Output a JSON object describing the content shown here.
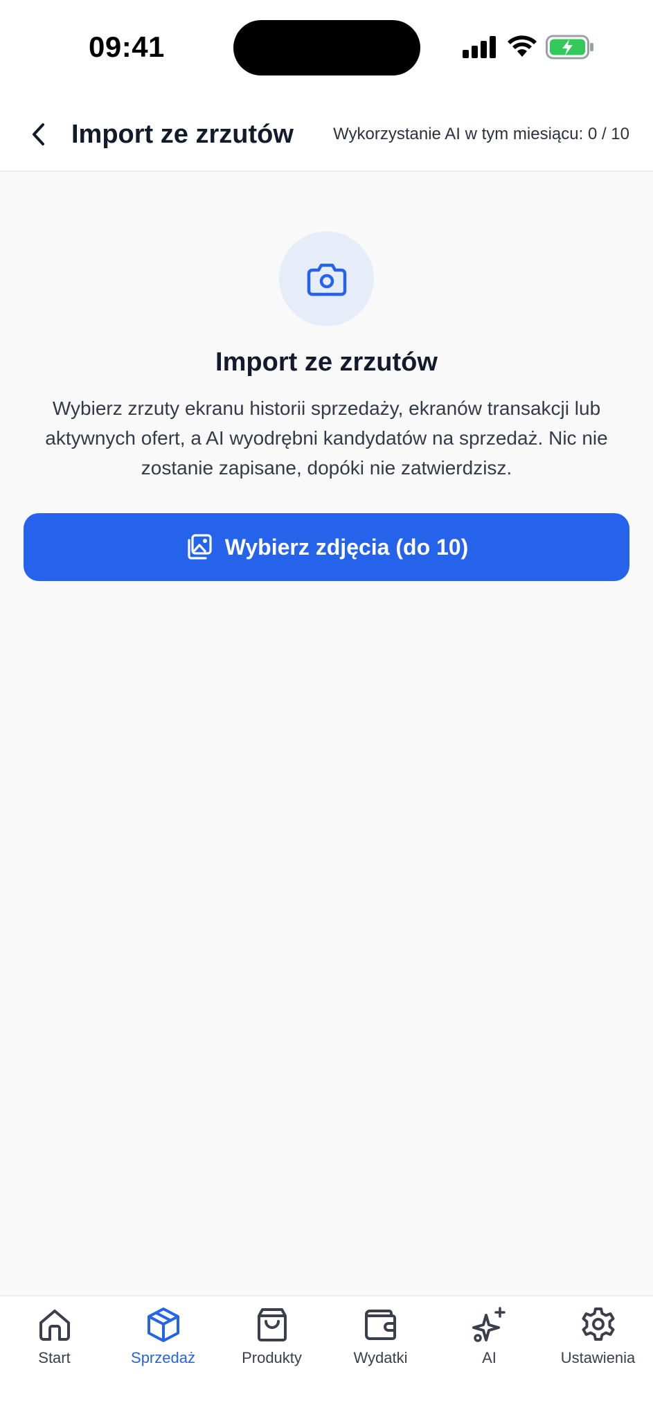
{
  "status": {
    "time": "09:41"
  },
  "header": {
    "title": "Import ze zrzutów",
    "usage": "Wykorzystanie AI w tym miesiącu: 0 / 10"
  },
  "main": {
    "title": "Import ze zrzutów",
    "description": "Wybierz zrzuty ekranu historii sprzedaży, ekranów transakcji lub aktywnych ofert, a AI wyodrębni kandydatów na sprzedaż. Nic nie zostanie zapisane, dopóki nie zatwierdzisz.",
    "button_label": "Wybierz zdjęcia (do 10)",
    "button_icon": "photo-library-icon",
    "hero_icon": "camera-icon"
  },
  "tabs": [
    {
      "label": "Start",
      "icon": "home-icon",
      "active": false
    },
    {
      "label": "Sprzedaż",
      "icon": "box-icon",
      "active": true
    },
    {
      "label": "Produkty",
      "icon": "shopping-bag-icon",
      "active": false
    },
    {
      "label": "Wydatki",
      "icon": "wallet-icon",
      "active": false
    },
    {
      "label": "AI",
      "icon": "sparkles-icon",
      "active": false
    },
    {
      "label": "Ustawienia",
      "icon": "gear-icon",
      "active": false
    }
  ],
  "colors": {
    "accent": "#2563eb",
    "accent_soft": "#e6ecf8",
    "text": "#131a2c",
    "background": "#f9f9fa",
    "battery_green": "#34c759"
  }
}
